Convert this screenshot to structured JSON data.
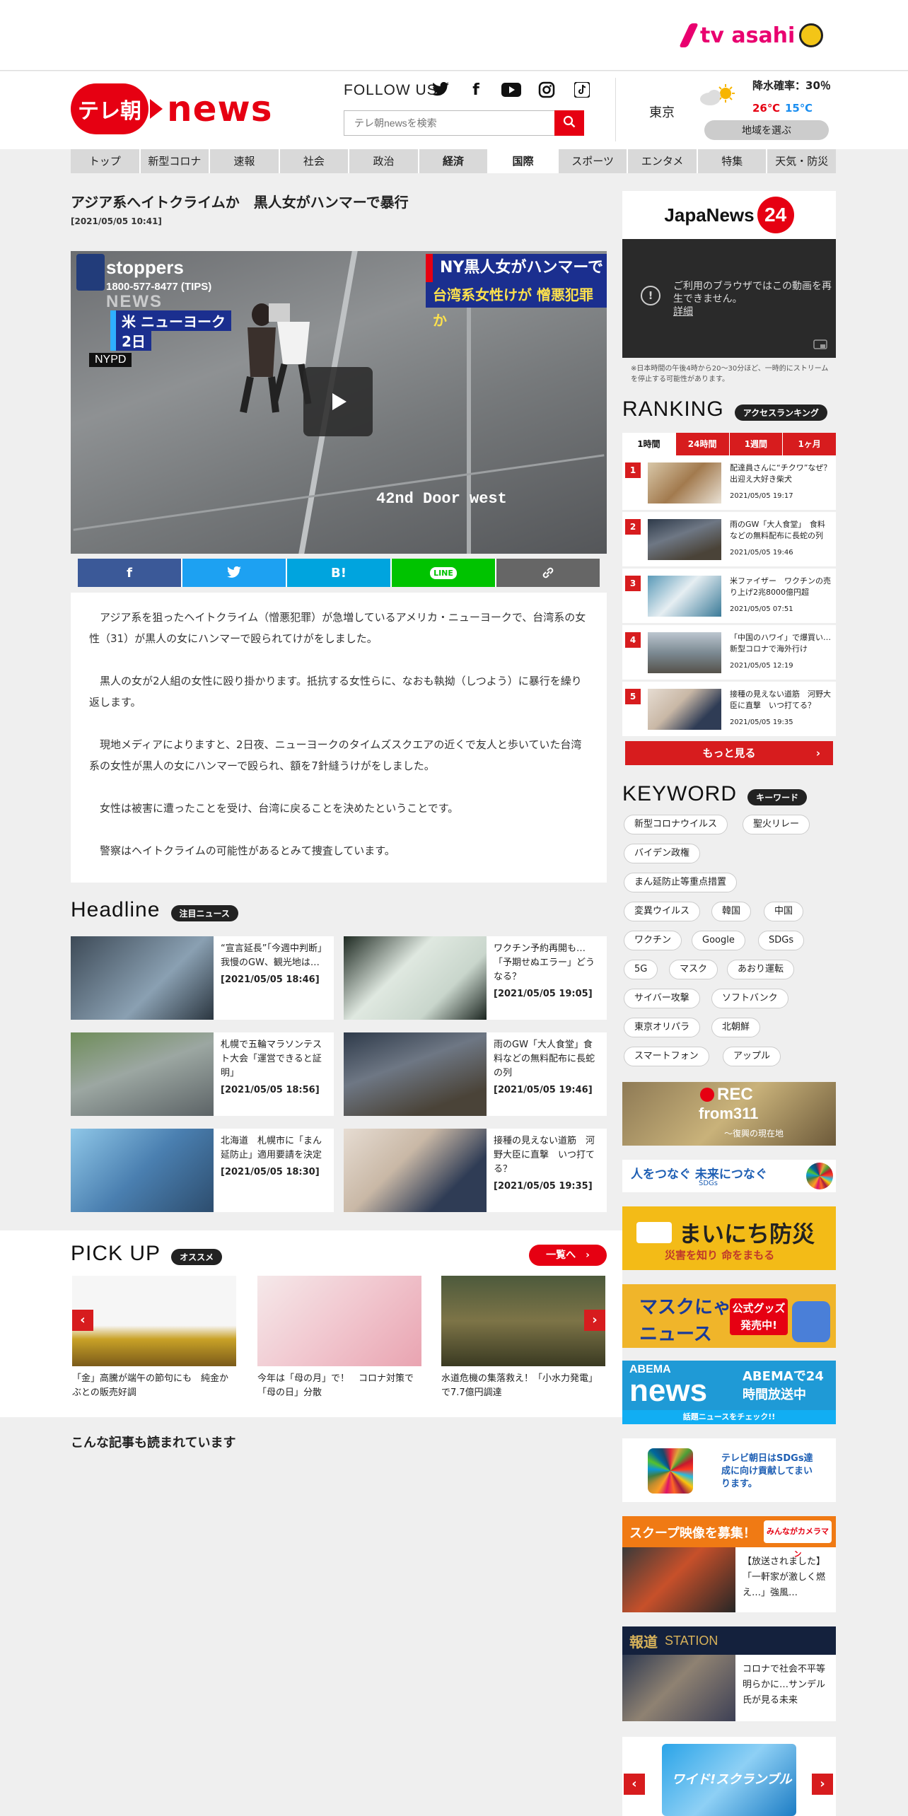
{
  "brand": {
    "tvasahi": "tv asahi",
    "logo_badge": "テレ朝",
    "logo_news": "news"
  },
  "header": {
    "follow_us": "FOLLOW US",
    "social": [
      "twitter-icon",
      "facebook-icon",
      "youtube-icon",
      "instagram-icon",
      "tiktok-icon"
    ],
    "search_placeholder": "テレ朝newsを検索",
    "weather": {
      "city": "東京",
      "rain": "降水確率：30％",
      "high": "26℃",
      "low": "15℃",
      "area_button": "地域を選ぶ"
    }
  },
  "nav": [
    "トップ",
    "新型コロナ",
    "速報",
    "社会",
    "政治",
    "経済",
    "国際",
    "スポーツ",
    "エンタメ",
    "特集",
    "天気・防災"
  ],
  "article": {
    "title": "アジア系へイトクライムか　黒人女がハンマーで暴行",
    "date": "[2021/05/05 10:41]",
    "video": {
      "crime_stoppers": "stoppers",
      "tips": "1800-577-8477 (TIPS)",
      "news_word": "NEWS",
      "loc_city": "米 ニューヨーク",
      "loc_date": "2日",
      "nypd": "NYPD",
      "tag1": "NY黒人女がハンマーで暴行",
      "tag2": "台湾系女性けが 憎悪犯罪か",
      "door": "42nd Door west"
    },
    "share": [
      "f",
      "t",
      "B!",
      "LINE",
      "link"
    ],
    "paragraphs": [
      "アジア系を狙ったヘイトクライム（憎悪犯罪）が急増しているアメリカ・ニューヨークで、台湾系の女性（31）が黒人の女にハンマーで殴られてけがをしました。",
      "黒人の女が2人組の女性に殴り掛かります。抵抗する女性らに、なおも執拗（しつよう）に暴行を繰り返します。",
      "現地メディアによりますと、2日夜、ニューヨークのタイムズスクエアの近くで友人と歩いていた台湾系の女性が黒人の女にハンマーで殴られ、額を7針縫うけがをしました。",
      "女性は被害に遭ったことを受け、台湾に戻ることを決めたということです。",
      "警察はヘイトクライムの可能性があるとみて捜査しています。"
    ]
  },
  "headline": {
    "title": "Headline",
    "pill": "注目ニュース",
    "items": [
      {
        "text": "“宣言延長”「今週中判断」　我慢のGW、観光地は…",
        "date": "[2021/05/05 18:46]"
      },
      {
        "text": "ワクチン予約再開も…「予期せぬエラー」どうなる？",
        "date": "[2021/05/05 19:05]"
      },
      {
        "text": "札幌で五輪マラソンテスト大会「運営できると証明」",
        "date": "[2021/05/05 18:56]"
      },
      {
        "text": "雨のGW「大人食堂」食料などの無料配布に長蛇の列",
        "date": "[2021/05/05 19:46]"
      },
      {
        "text": "北海道　札幌市に「まん延防止」適用要請を決定",
        "date": "[2021/05/05 18:30]"
      },
      {
        "text": "接種の見えない道筋　河野大臣に直撃　いつ打てる？",
        "date": "[2021/05/05 19:35]"
      }
    ]
  },
  "pickup": {
    "title": "PICK UP",
    "pill": "オススメ",
    "more": "一覧へ　›",
    "items": [
      {
        "text": "「金」高騰が端午の節句にも　純金かぶとの販売好調"
      },
      {
        "text": "今年は「母の月」で！　コロナ対策で「母の日」分散"
      },
      {
        "text": "水道危機の集落救え！「小水力発電」で7.7億円調達"
      }
    ]
  },
  "read_more_title": "こんな記事も読まれています",
  "sidebar": {
    "japanews": "JapaNews",
    "japanews_num": "24",
    "video_msg": "ご利用のブラウザではこの動画を再生できません。",
    "video_link": "詳細",
    "note": "※日本時間の午後4時から20～30分ほど、一時的にストリームを停止する可能性があります。",
    "ranking_title": "RANKING",
    "ranking_pill": "アクセスランキング",
    "ranking_tabs": [
      "1時間",
      "24時間",
      "1週間",
      "1ヶ月"
    ],
    "ranking": [
      {
        "n": "1",
        "text": "配達員さんに“チクワ”なぜ？　出迎え大好き柴犬",
        "date": "2021/05/05 19:17"
      },
      {
        "n": "2",
        "text": "雨のGW「大人食堂」　食料などの無料配布に長蛇の列",
        "date": "2021/05/05 19:46"
      },
      {
        "n": "3",
        "text": "米ファイザー　ワクチンの売り上げ2兆8000億円超",
        "date": "2021/05/05 07:51"
      },
      {
        "n": "4",
        "text": "「中国のハワイ」で爆買い…新型コロナで海外行け",
        "date": "2021/05/05 12:19"
      },
      {
        "n": "5",
        "text": "接種の見えない道筋　河野大臣に直撃　いつ打てる？",
        "date": "2021/05/05 19:35"
      }
    ],
    "more": "もっと見る",
    "keyword_title": "KEYWORD",
    "keyword_pill": "キーワード",
    "keywords": [
      "新型コロナウイルス",
      "聖火リレー",
      "バイデン政権",
      "まん延防止等重点措置",
      "変異ウイルス",
      "韓国",
      "中国",
      "ワクチン",
      "Google",
      "SDGs",
      "5G",
      "マスク",
      "あおり運転",
      "サイバー攻撃",
      "ソフトバンク",
      "東京オリパラ",
      "北朝鮮",
      "スマートフォン",
      "アップル"
    ],
    "banners": {
      "rec": "REC",
      "rec_from": "from311",
      "rec_sub": "～復興の現在地",
      "sdgs": "人をつなぐ 未来につなぐ",
      "sdgs_small": "SDGs",
      "bousai": "まいにち防災",
      "bousai_sub": "災害を知り 命をまもる",
      "mask": "マスクにゃん",
      "mask_news": "ニュース",
      "mask_goods": "公式グッズ発売中!",
      "abema": "ABEMA",
      "abema_news": "news",
      "abema_right": "ABEMAで24時間放送中",
      "abema_sub": "話題ニュースをチェック!!",
      "sdgs2": "テレビ朝日はSDGs達成に向け貢献してまいります。",
      "scoop": "スクープ映像を募集！",
      "scoop_sub": "みんながカメラマン",
      "scoop_text": "【放送されました】「一軒家が激しく燃え…」強風…",
      "hodo": "報道",
      "hodo_station": "STATION",
      "hodo_text": "コロナで社会不平等明らかに…サンデル氏が見る未来",
      "wide": "ワイド!スクランブル"
    }
  }
}
